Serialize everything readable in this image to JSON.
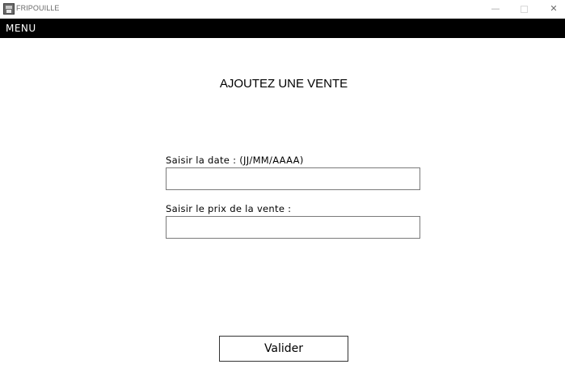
{
  "window": {
    "title": "FRIPOUILLE",
    "icon": "app-icon",
    "controls": {
      "minimize": "—",
      "close": "✕"
    }
  },
  "menubar": {
    "menu_label": "MENU"
  },
  "form": {
    "heading": "AJOUTEZ UNE VENTE",
    "date_label": "Saisir la date : (JJ/MM/AAAA)",
    "date_value": "",
    "price_label": "Saisir le prix de la vente :",
    "price_value": "",
    "submit_label": "Valider"
  }
}
